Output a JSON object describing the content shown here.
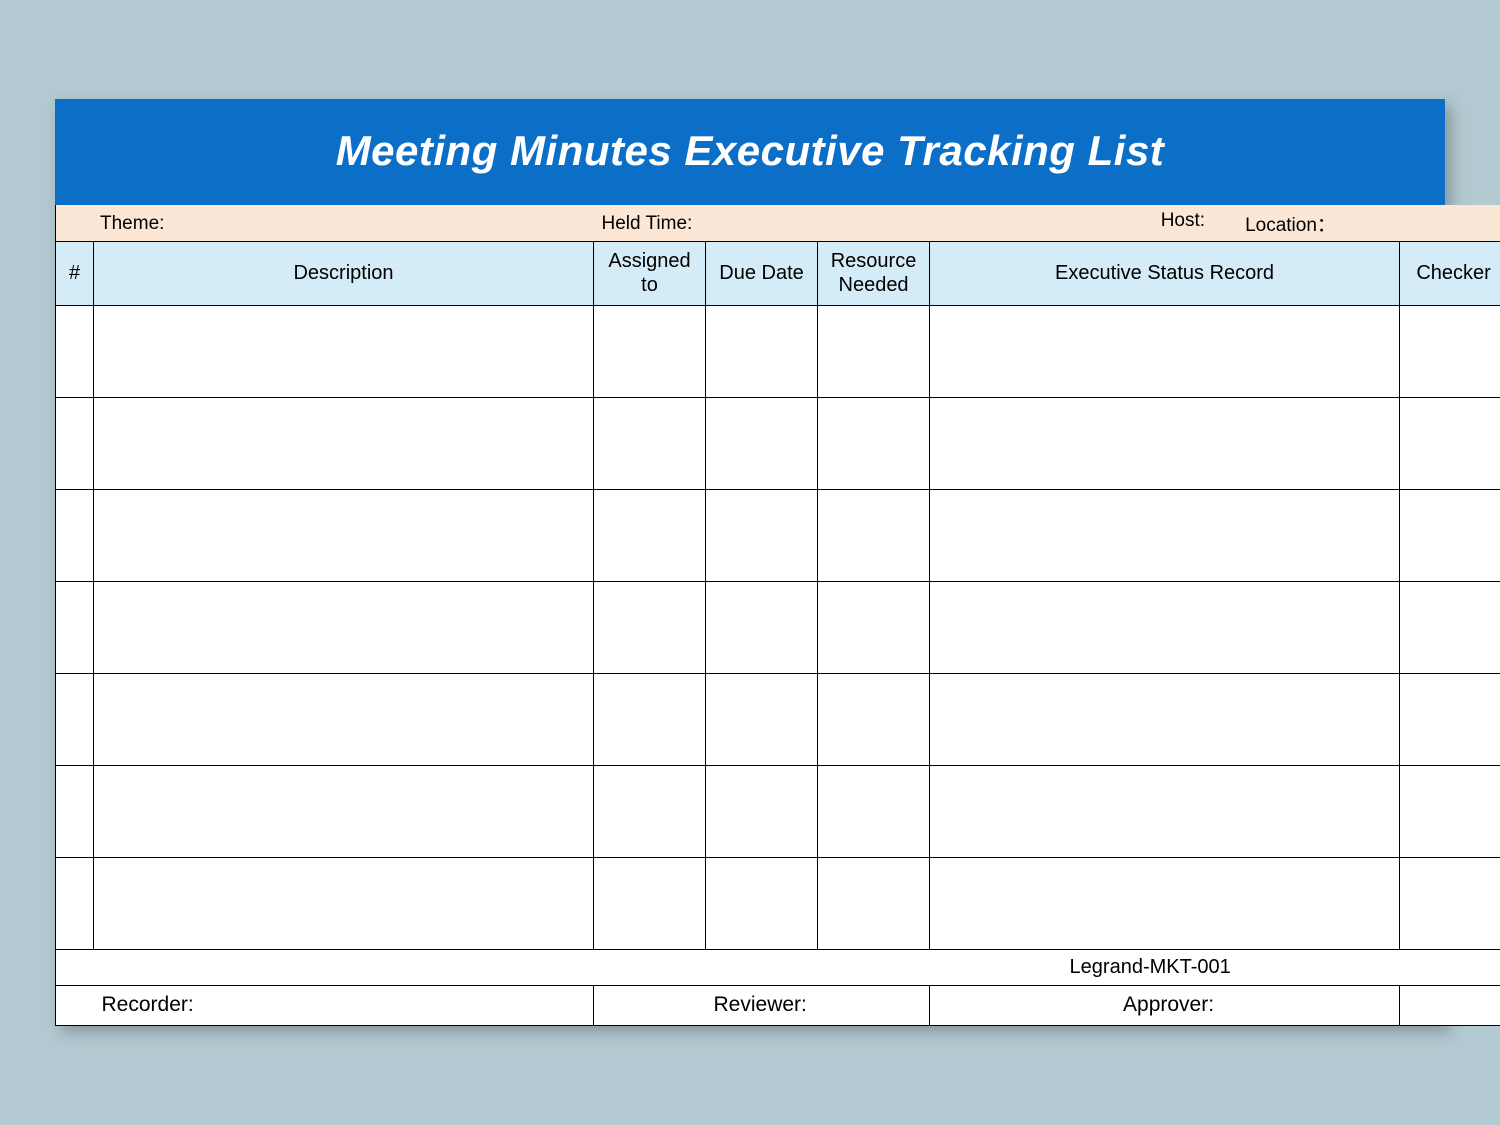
{
  "title": "Meeting Minutes Executive Tracking List",
  "meta": {
    "theme_label": "Theme:",
    "held_time_label": "Held Time:",
    "host_label": "Host:",
    "location_label": "Location："
  },
  "columns": {
    "num": "#",
    "description": "Description",
    "assigned_to": "Assigned to",
    "due_date": "Due Date",
    "resource_needed": "Resource Needed",
    "status_record": "Executive Status Record",
    "checker": "Checker"
  },
  "rows": [
    {},
    {},
    {},
    {},
    {},
    {},
    {}
  ],
  "doc_code": "Legrand-MKT-001",
  "footer": {
    "recorder_label": "Recorder:",
    "reviewer_label": "Reviewer:",
    "approver_label": "Approver:"
  }
}
